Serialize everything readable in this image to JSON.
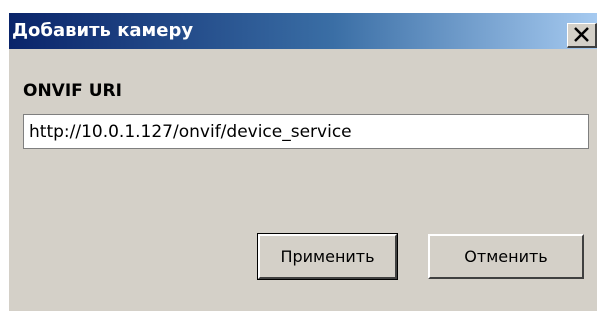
{
  "dialog": {
    "title": "Добавить камеру",
    "field_label": "ONVIF URI",
    "uri_value": "http://10.0.1.127/onvif/device_service",
    "apply_label": "Применить",
    "cancel_label": "Отменить",
    "close_icon": "close-icon"
  },
  "colors": {
    "titlebar_start": "#0a246a",
    "titlebar_end": "#a6caf0",
    "dialog_background": "#d4d0c8"
  }
}
